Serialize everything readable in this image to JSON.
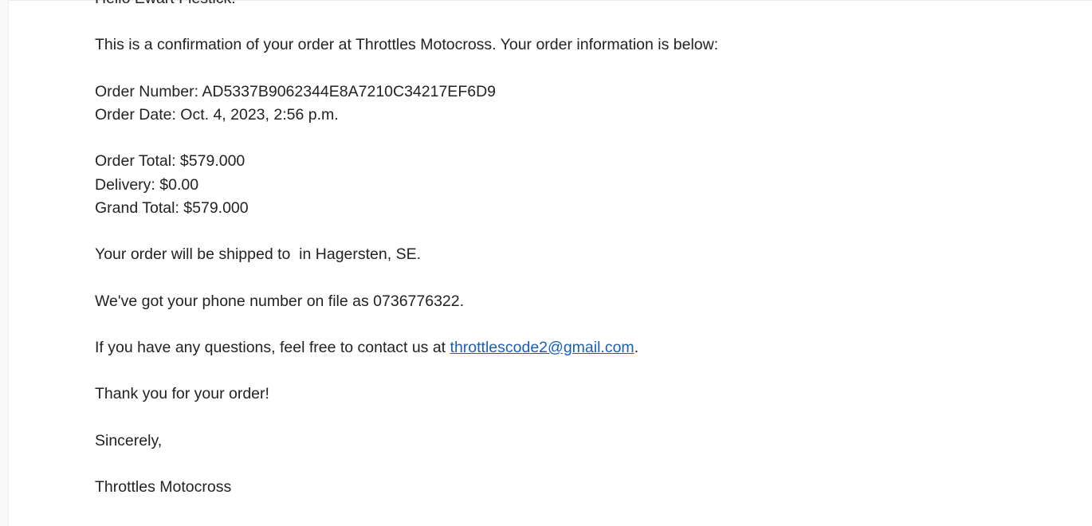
{
  "email": {
    "greeting": "Hello Ewart Flestick!",
    "intro": "This is a confirmation of your order at Throttles Motocross. Your order information is below:",
    "order_number": "Order Number: AD5337B9062344E8A7210C34217EF6D9",
    "order_date": "Order Date: Oct. 4, 2023, 2:56 p.m.",
    "order_total": "Order Total: $579.000",
    "delivery": "Delivery: $0.00",
    "grand_total": "Grand Total: $579.000",
    "shipping": "Your order will be shipped to  in Hagersten, SE.",
    "phone": "We've got your phone number on file as 0736776322.",
    "contact_prefix": "If you have any questions, feel free to contact us at ",
    "contact_email": "throttlescode2@gmail.com",
    "contact_suffix": ".",
    "thanks": "Thank you for your order!",
    "closing": "Sincerely,",
    "signature": "Throttles Motocross"
  },
  "colors": {
    "link": "#1a5fb4",
    "text": "#222222",
    "background": "#ffffff"
  }
}
